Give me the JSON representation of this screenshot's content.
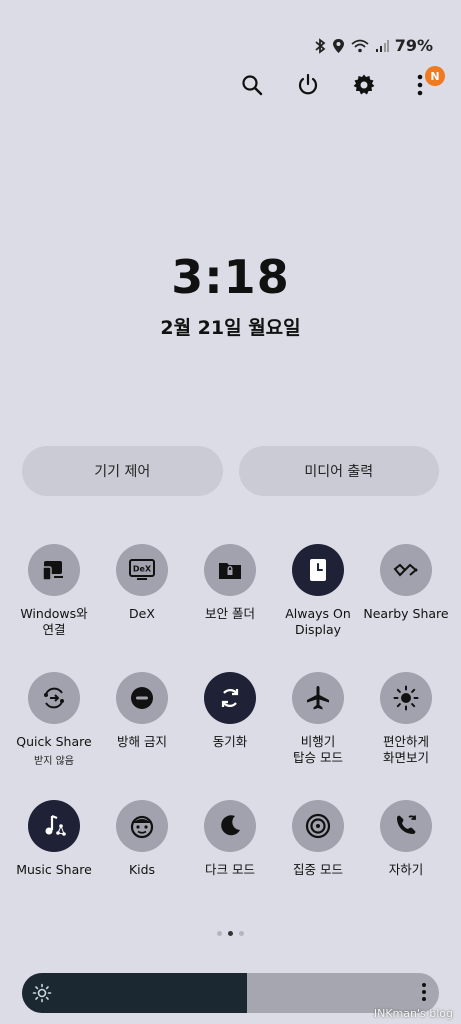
{
  "status": {
    "battery": "79%",
    "icons": [
      "bluetooth-icon",
      "location-icon",
      "wifi-icon",
      "signal-icon"
    ]
  },
  "top_actions": {
    "icons": [
      "search-icon",
      "power-icon",
      "gear-icon",
      "more-vertical-icon"
    ],
    "notification_badge": "N"
  },
  "clock": {
    "time": "3:18",
    "date": "2월 21일 월요일"
  },
  "pills": {
    "device_control": "기기 제어",
    "media_output": "미디어 출력"
  },
  "tiles": [
    {
      "label": "Windows와\n연결",
      "sub": "",
      "icon": "windows-link-icon",
      "active": false
    },
    {
      "label": "DeX",
      "sub": "",
      "icon": "dex-icon",
      "icon_text": "DeX",
      "active": false
    },
    {
      "label": "보안 폴더",
      "sub": "",
      "icon": "secure-folder-icon",
      "active": false
    },
    {
      "label": "Always On\nDisplay",
      "sub": "",
      "icon": "clock-icon",
      "active": true
    },
    {
      "label": "Nearby Share",
      "sub": "",
      "icon": "nearby-share-icon",
      "active": false
    },
    {
      "label": "Quick Share",
      "sub": "받지 않음",
      "icon": "quick-share-icon",
      "active": false
    },
    {
      "label": "방해 금지",
      "sub": "",
      "icon": "do-not-disturb-icon",
      "active": false
    },
    {
      "label": "동기화",
      "sub": "",
      "icon": "sync-icon",
      "active": true
    },
    {
      "label": "비행기\n탑승 모드",
      "sub": "",
      "icon": "airplane-icon",
      "active": false
    },
    {
      "label": "편안하게\n화면보기",
      "sub": "",
      "icon": "eye-comfort-icon",
      "active": false
    },
    {
      "label": "Music Share",
      "sub": "",
      "icon": "music-share-icon",
      "active": true
    },
    {
      "label": "Kids",
      "sub": "",
      "icon": "kids-icon",
      "active": false
    },
    {
      "label": "다크 모드",
      "sub": "",
      "icon": "dark-mode-icon",
      "active": false
    },
    {
      "label": "집중 모드",
      "sub": "",
      "icon": "focus-mode-icon",
      "active": false
    },
    {
      "label": "자하기",
      "sub": "",
      "icon": "call-forward-icon",
      "active": false
    }
  ],
  "pager": {
    "count": 3,
    "active_index": 1
  },
  "brightness": {
    "level": 0.54
  },
  "watermark": "INKman's blog",
  "colors": {
    "background": "#dcdce6",
    "tile_on": "#1f2236",
    "tile_off": "#a2a2ae",
    "badge": "#f07a1f"
  }
}
